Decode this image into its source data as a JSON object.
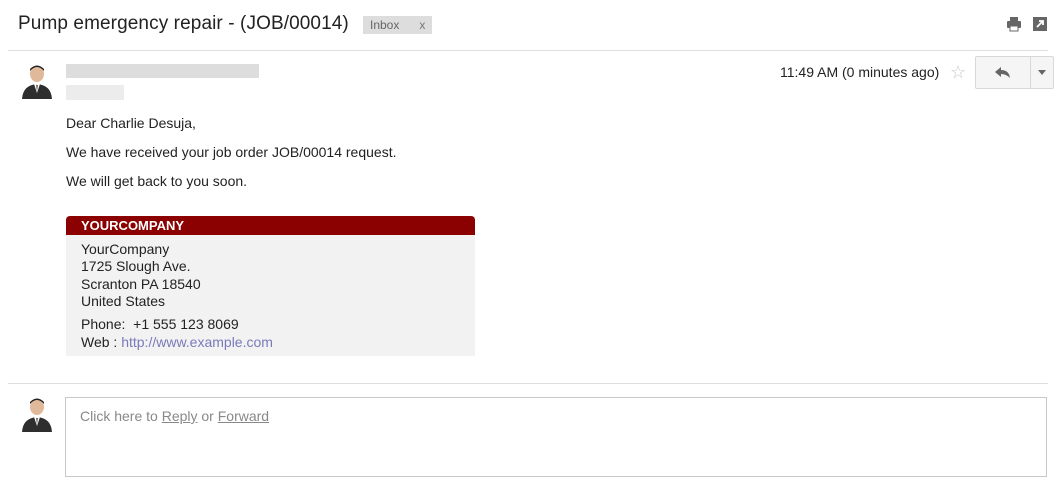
{
  "subject": "Pump emergency repair - (JOB/00014)",
  "label": {
    "name": "Inbox",
    "remove": "x"
  },
  "icons": {
    "print": "print-icon",
    "popout": "new-window-icon",
    "star": "star-icon",
    "reply": "reply-icon",
    "more": "chevron-down-icon",
    "avatar": "person-avatar-icon"
  },
  "message": {
    "timestamp": "11:49 AM (0 minutes ago)",
    "star": "☆",
    "greeting": "Dear Charlie Desuja,",
    "line1": "We have received your job order JOB/00014 request.",
    "line2": "We will get back to you soon."
  },
  "signature": {
    "header": "YOURCOMPANY",
    "company": "YourCompany",
    "street": "1725 Slough Ave.",
    "city": "Scranton PA 18540",
    "country": "United States",
    "phone_label": "Phone:",
    "phone": "+1 555 123 8069",
    "web_label": "Web :",
    "web": "http://www.example.com"
  },
  "reply": {
    "prefix": "Click here to ",
    "reply_link": "Reply",
    "or": " or ",
    "forward_link": "Forward"
  },
  "colors": {
    "signature_header": "#8b0000",
    "link": "#7a7aba"
  }
}
